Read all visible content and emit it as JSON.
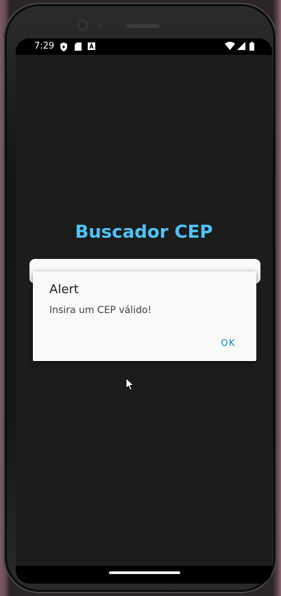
{
  "status_bar": {
    "time": "7:29",
    "icons_left": [
      "play-protect-icon",
      "sd-card-icon",
      "font-a-icon"
    ],
    "icons_right": [
      "wifi-icon",
      "cell-signal-icon",
      "battery-icon"
    ]
  },
  "app": {
    "title": "Buscador CEP",
    "title_color": "#4fc3f7",
    "background": "#1c1c1c"
  },
  "dialog": {
    "title": "Alert",
    "message": "Insira um CEP válido!",
    "ok_label": "OK",
    "accent": "#0288d1"
  }
}
